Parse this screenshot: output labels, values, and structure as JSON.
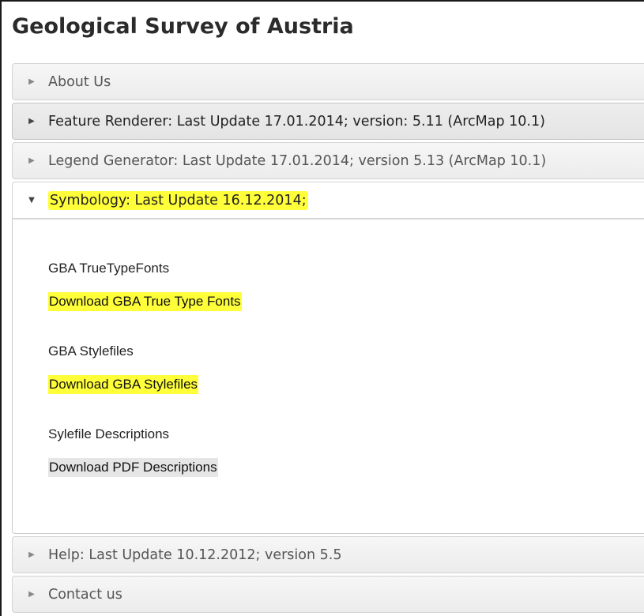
{
  "page": {
    "title": "Geological Survey of Austria"
  },
  "accordion": {
    "items": [
      {
        "label": "About Us",
        "state": "collapsed"
      },
      {
        "label": "Feature Renderer: Last Update 17.01.2014; version: 5.11 (ArcMap 10.1)",
        "state": "collapsed"
      },
      {
        "label": "Legend Generator: Last Update 17.01.2014; version 5.13 (ArcMap 10.1)",
        "state": "collapsed"
      },
      {
        "label": "Symbology: Last Update 16.12.2014;",
        "state": "expanded"
      },
      {
        "label": "Help: Last Update 10.12.2012; version 5.5",
        "state": "collapsed"
      },
      {
        "label": "Contact us",
        "state": "collapsed"
      }
    ]
  },
  "symbology_panel": {
    "sections": [
      {
        "title": "GBA TrueTypeFonts",
        "link": "Download GBA True Type Fonts"
      },
      {
        "title": "GBA Stylefiles",
        "link": "Download GBA Stylefiles"
      },
      {
        "title": "Sylefile Descriptions",
        "link": "Download PDF Descriptions"
      }
    ]
  },
  "icons": {
    "collapsed": "triangle-right-icon",
    "expanded": "triangle-down-icon"
  },
  "colors": {
    "highlight": "#ffff3a",
    "link_background": "#e6e6e6",
    "header_border": "#d3d3d3"
  }
}
